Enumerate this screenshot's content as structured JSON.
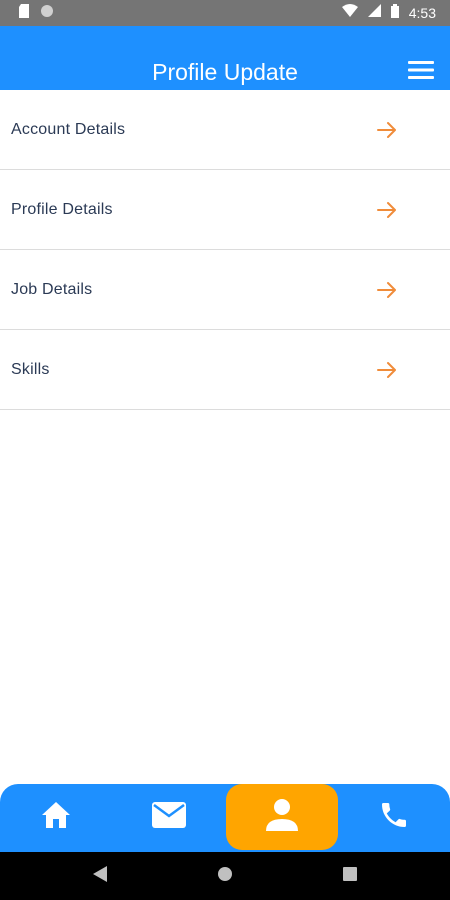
{
  "status_bar": {
    "time": "4:53",
    "icons": [
      "sd-card-icon",
      "sync-icon",
      "wifi-icon",
      "signal-icon",
      "battery-icon"
    ]
  },
  "app_bar": {
    "title": "Profile Update",
    "menu_icon": "hamburger-menu-icon",
    "background": "#1e90ff"
  },
  "list": {
    "items": [
      {
        "label": "Account Details",
        "icon": "arrow-right-icon"
      },
      {
        "label": "Profile Details",
        "icon": "arrow-right-icon"
      },
      {
        "label": "Job Details",
        "icon": "arrow-right-icon"
      },
      {
        "label": "Skills",
        "icon": "arrow-right-icon"
      }
    ],
    "arrow_color": "#f08c3a",
    "label_color": "#2b3a55"
  },
  "bottom_nav": {
    "items": [
      {
        "icon": "home-icon",
        "active": false
      },
      {
        "icon": "mail-icon",
        "active": false
      },
      {
        "icon": "person-icon",
        "active": true
      },
      {
        "icon": "phone-icon",
        "active": false
      }
    ],
    "background": "#1e90ff",
    "active_color": "#ffa500"
  },
  "system_nav": {
    "buttons": [
      "back-icon",
      "home-circle-icon",
      "recents-icon"
    ]
  }
}
